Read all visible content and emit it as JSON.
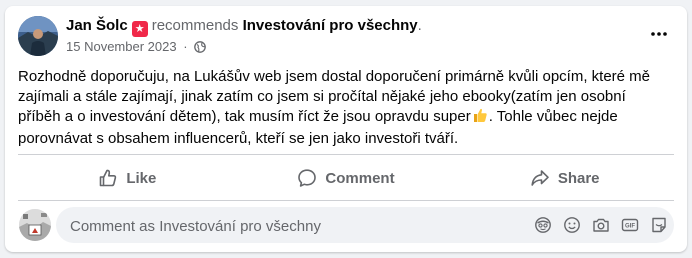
{
  "post": {
    "author": "Jan Šolc",
    "verb": "recommends",
    "page_name": "Investování pro všechny",
    "trailing": ".",
    "date": "15 November 2023",
    "meta_sep": "·",
    "text_before_emoji": "Rozhodně doporučuju, na Lukášův web jsem dostal doporučení primárně kvůli opcím, které mě zajímali a stále zajímají, jinak zatím co jsem si pročítal nějaké jeho ebooky(zatím jen osobní příběh a o investování dětem), tak musím říct že jsou opravdu super",
    "emoji": "thumbs-up",
    "text_after_emoji": ". Tohle vůbec nejde porovnávat s obsahem influencerů, kteří se jen jako investoři tváří."
  },
  "actions": {
    "like": "Like",
    "comment": "Comment",
    "share": "Share"
  },
  "comment_box": {
    "placeholder": "Comment as Investování pro všechny",
    "value": ""
  },
  "icons": {
    "badge": "recommend-star-icon",
    "privacy": "globe-icon",
    "more": "more-options-icon",
    "composer": [
      "avatar-sticker-icon",
      "emoji-icon",
      "camera-icon",
      "gif-icon",
      "sticker-icon"
    ]
  },
  "colors": {
    "badge": "#f02849",
    "secondary_text": "#65676b",
    "input_bg": "#f0f2f5"
  }
}
